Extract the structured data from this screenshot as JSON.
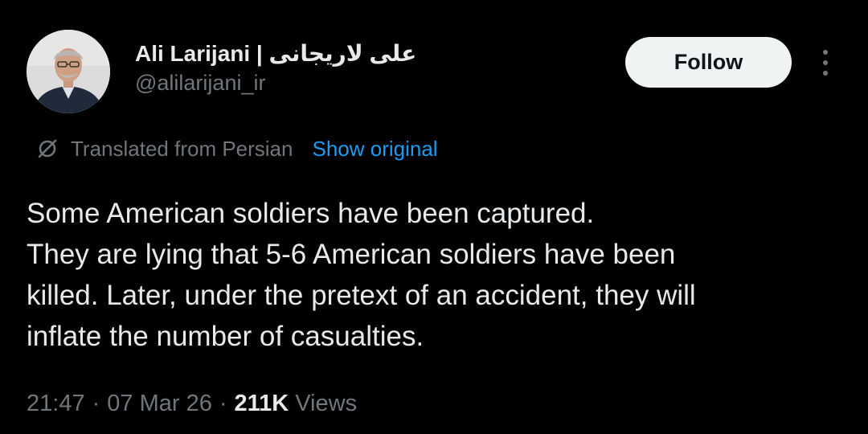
{
  "author": {
    "display_name": "Ali Larijani | علی لاریجانی",
    "handle": "@alilarijani_ir"
  },
  "actions": {
    "follow_label": "Follow"
  },
  "translation": {
    "label": "Translated from Persian",
    "show_original_label": "Show original"
  },
  "tweet": {
    "lines": [
      "Some American soldiers have been captured.",
      "They are lying that 5-6 American soldiers have been",
      "killed. Later, under the pretext of an accident, they will",
      "inflate the number of casualties."
    ]
  },
  "meta": {
    "time": "21:47",
    "separator": "·",
    "date": "07 Mar 26",
    "views_count": "211K",
    "views_label": "Views"
  },
  "colors": {
    "background": "#000000",
    "primary_text": "#e7e9ea",
    "secondary_text": "#71767b",
    "link": "#1d9bf0",
    "follow_button_bg": "#eff3f4"
  },
  "icons": {
    "translate": "translate-icon",
    "more": "more-options-icon"
  }
}
